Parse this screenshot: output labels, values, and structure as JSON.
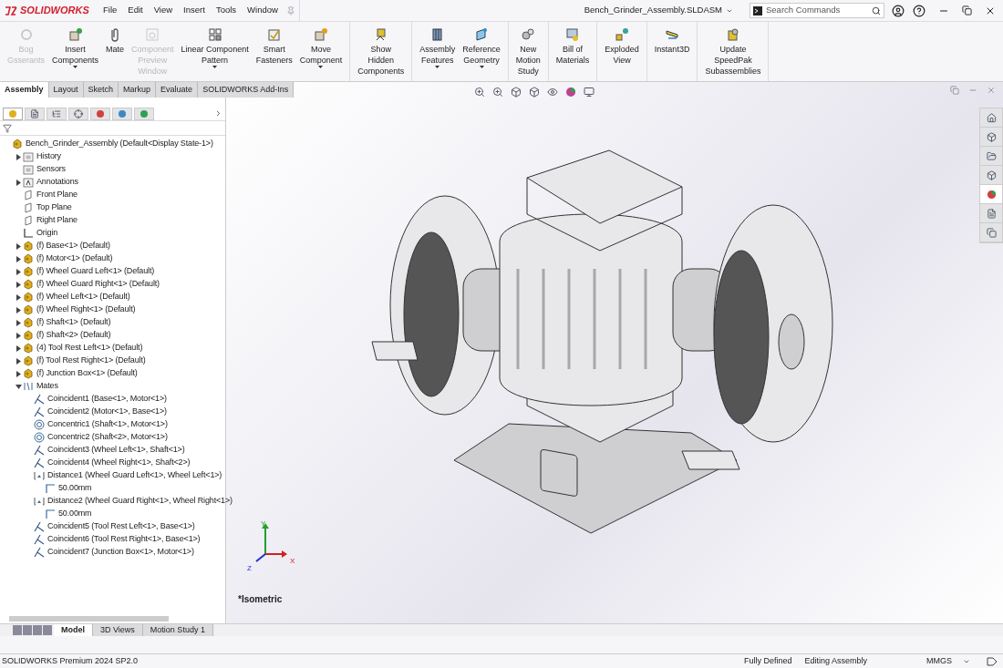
{
  "title_bar": {
    "logo": "SOLIDWORKS",
    "menu": [
      "File",
      "Edit",
      "View",
      "Insert",
      "Tools",
      "Window"
    ],
    "document": "Bench_Grinder_Assembly.SLDASM",
    "search": {
      "placeholder": "Search Commands"
    }
  },
  "ribbon": {
    "groups": [
      {
        "buttons": [
          {
            "lines": [
              "Bog",
              "Gsserants"
            ],
            "disabled": true,
            "dropdown": false
          },
          {
            "lines": [
              "Insert",
              "Components"
            ],
            "disabled": false,
            "dropdown": true
          },
          {
            "lines": [
              "Mate"
            ],
            "disabled": false,
            "dropdown": false
          },
          {
            "lines": [
              "Component",
              "Preview",
              "Window"
            ],
            "disabled": true,
            "dropdown": false
          },
          {
            "lines": [
              "Linear Component",
              "Pattern"
            ],
            "disabled": false,
            "dropdown": true
          },
          {
            "lines": [
              "Smart",
              "Fasteners"
            ],
            "disabled": false,
            "dropdown": false
          },
          {
            "lines": [
              "Move",
              "Component"
            ],
            "disabled": false,
            "dropdown": true
          }
        ]
      },
      {
        "buttons": [
          {
            "lines": [
              "Show",
              "Hidden",
              "Components"
            ],
            "disabled": false,
            "dropdown": false
          }
        ]
      },
      {
        "buttons": [
          {
            "lines": [
              "Assembly",
              "Features"
            ],
            "disabled": false,
            "dropdown": true
          },
          {
            "lines": [
              "Reference",
              "Geometry"
            ],
            "disabled": false,
            "dropdown": true
          }
        ]
      },
      {
        "buttons": [
          {
            "lines": [
              "New",
              "Motion",
              "Study"
            ],
            "disabled": false,
            "dropdown": false
          }
        ]
      },
      {
        "buttons": [
          {
            "lines": [
              "Bill of",
              "Materials"
            ],
            "disabled": false,
            "dropdown": false
          }
        ]
      },
      {
        "buttons": [
          {
            "lines": [
              "Exploded",
              "View"
            ],
            "disabled": false,
            "dropdown": false
          }
        ]
      },
      {
        "buttons": [
          {
            "lines": [
              "Instant3D"
            ],
            "disabled": false,
            "dropdown": false
          }
        ]
      },
      {
        "buttons": [
          {
            "lines": [
              "Update",
              "SpeedPak",
              "Subassemblies"
            ],
            "disabled": false,
            "dropdown": false
          }
        ]
      }
    ]
  },
  "command_tabs": [
    {
      "label": "Assembly",
      "selected": true
    },
    {
      "label": "Layout",
      "selected": false
    },
    {
      "label": "Sketch",
      "selected": false
    },
    {
      "label": "Markup",
      "selected": false
    },
    {
      "label": "Evaluate",
      "selected": false
    },
    {
      "label": "SOLIDWORKS Add-Ins",
      "selected": false
    }
  ],
  "feature_tree": {
    "root": {
      "kind": "assembly",
      "label": "Bench_Grinder_Assembly  (Default<Display State-1>)",
      "children": [
        {
          "kind": "folder",
          "label": "History",
          "expanded": false
        },
        {
          "kind": "folder",
          "label": "Sensors"
        },
        {
          "kind": "annotation",
          "label": "Annotations",
          "expanded": false
        },
        {
          "kind": "plane",
          "label": "Front Plane"
        },
        {
          "kind": "plane",
          "label": "Top Plane"
        },
        {
          "kind": "plane",
          "label": "Right Plane"
        },
        {
          "kind": "origin",
          "label": "Origin"
        },
        {
          "kind": "part",
          "label": "(f) Base<1> (Default)",
          "expanded": false
        },
        {
          "kind": "part",
          "label": "(f) Motor<1> (Default)",
          "expanded": false
        },
        {
          "kind": "part",
          "label": "(f) Wheel Guard Left<1> (Default)",
          "expanded": false
        },
        {
          "kind": "part",
          "label": "(f) Wheel Guard Right<1> (Default)",
          "expanded": false
        },
        {
          "kind": "part",
          "label": "(f) Wheel Left<1> (Default)",
          "expanded": false
        },
        {
          "kind": "part",
          "label": "(f) Wheel Right<1> (Default)",
          "expanded": false
        },
        {
          "kind": "part",
          "label": "(f) Shaft<1> (Default)",
          "expanded": false
        },
        {
          "kind": "part",
          "label": "(f) Shaft<2> (Default)",
          "expanded": false
        },
        {
          "kind": "part",
          "label": "(4) Tool Rest Left<1> (Default)",
          "expanded": false
        },
        {
          "kind": "part",
          "label": "(f) Tool Rest Right<1> (Default)",
          "expanded": false
        },
        {
          "kind": "part",
          "label": "(f) Junction Box<1> (Default)",
          "expanded": false
        },
        {
          "kind": "mates",
          "label": "Mates",
          "expanded": true,
          "children": [
            {
              "kind": "coincident",
              "label": "Coincident1 (Base<1>, Motor<1>)"
            },
            {
              "kind": "coincident",
              "label": "Coincident2 (Motor<1>, Base<1>)"
            },
            {
              "kind": "concentric",
              "label": "Concentric1 (Shaft<1>, Motor<1>)"
            },
            {
              "kind": "concentric",
              "label": "Concentric2 (Shaft<2>, Motor<1>)"
            },
            {
              "kind": "coincident",
              "label": "Coincident3 (Wheel Left<1>, Shaft<1>)"
            },
            {
              "kind": "coincident",
              "label": "Coincident4 (Wheel Right<1>, Shaft<2>)"
            },
            {
              "kind": "distance",
              "label": "Distance1 (Wheel Guard Left<1>, Wheel Left<1>)",
              "children": [
                {
                  "kind": "dimension",
                  "label": "50.00mm"
                }
              ]
            },
            {
              "kind": "distance",
              "label": "Distance2 (Wheel Guard Right<1>, Wheel Right<1>)",
              "children": [
                {
                  "kind": "dimension",
                  "label": "50.00mm"
                }
              ]
            },
            {
              "kind": "coincident",
              "label": "Coincident5 (Tool Rest Left<1>, Base<1>)"
            },
            {
              "kind": "coincident",
              "label": "Coincident6 (Tool Rest Right<1>, Base<1>)"
            },
            {
              "kind": "coincident",
              "label": "Coincident7 (Junction Box<1>, Motor<1>)"
            }
          ]
        }
      ]
    }
  },
  "manager_tabs": [
    {
      "selected": true
    },
    {
      "selected": false
    },
    {
      "selected": false
    },
    {
      "selected": false
    },
    {
      "selected": false
    },
    {
      "selected": false
    },
    {
      "selected": false
    }
  ],
  "task_pane": [
    {
      "selected": false
    },
    {
      "selected": false
    },
    {
      "selected": false
    },
    {
      "selected": false
    },
    {
      "selected": true
    },
    {
      "selected": false
    },
    {
      "selected": false
    }
  ],
  "viewport": {
    "view_name": "*Isometric",
    "triad": {
      "x": "X",
      "y": "Y",
      "z": "Z"
    }
  },
  "bottom_tabs": [
    {
      "label": "Model",
      "selected": true
    },
    {
      "label": "3D Views",
      "selected": false
    },
    {
      "label": "Motion Study 1",
      "selected": false
    }
  ],
  "status_bar": {
    "product": "SOLIDWORKS Premium 2024 SP2.0",
    "state": "Fully Defined",
    "mode": "Editing Assembly",
    "units": "MMGS"
  }
}
